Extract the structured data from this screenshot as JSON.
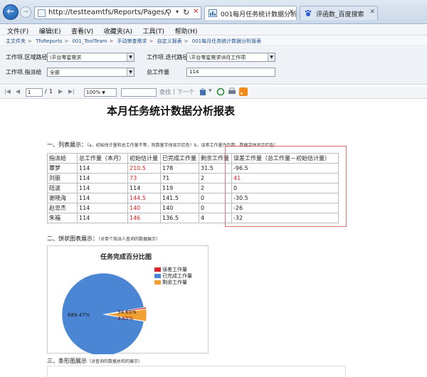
{
  "browser": {
    "address_url": "http://testteamtfs/Reports/Pages/",
    "tabs": [
      {
        "label": "001每月任务统计数据分析..."
      },
      {
        "label": "评函数_百度搜索"
      }
    ]
  },
  "menu": [
    "文件(F)",
    "编辑(E)",
    "查看(V)",
    "收藏夹(A)",
    "工具(T)",
    "帮助(H)"
  ],
  "breadcrumb": [
    "主文件夹",
    "TfsReports",
    "001_ToolTeam",
    "手动审查需求",
    "自定义报表",
    "001每月任务统计数据分析报表"
  ],
  "params": {
    "area_path_label": "工作项.区域路径",
    "area_path_value": "\\平台零星需求",
    "iteration_label": "工作项.迭代路径",
    "iteration_value": "\\平台零星需求\\8月工作项",
    "assigned_label": "工作项.指派给",
    "assigned_value": "全部",
    "total_label": "总工作量",
    "total_value": "114"
  },
  "report_toolbar": {
    "page_current": "1",
    "page_sep": "/",
    "page_total": "1",
    "zoom": "100%",
    "find_label": "查找",
    "next_label": "下一个"
  },
  "report": {
    "title": "本月任务统计数据分析报表",
    "section1_title": "一、列表展示：",
    "section1_note": "（a，初始估计量和总工作量不等，则数量字体显示红色！b，误差工作量为负数，数据字体显示红色）",
    "section2_title": "二、饼状图表展示：",
    "section2_note": "（对单个指派人查询的数据展示）",
    "section3_title": "三、条形图展示",
    "section3_note": "（对查询的数据总和的展示）",
    "table": {
      "headers": [
        "指派给",
        "总工作量（本月）",
        "初始估计量",
        "已完成工作量",
        "剩余工作量",
        "误差工作量（总工作量－初始估计量）"
      ],
      "rows": [
        {
          "name": "覃梦",
          "total": "114",
          "estimate": "210.5",
          "estimate_red": true,
          "done": "178",
          "remain": "31.5",
          "diff": "-96.5",
          "diff_red": false
        },
        {
          "name": "刘丽",
          "total": "114",
          "estimate": "73",
          "estimate_red": true,
          "done": "71",
          "remain": "2",
          "diff": "41",
          "diff_red": true
        },
        {
          "name": "陆波",
          "total": "114",
          "estimate": "114",
          "estimate_red": false,
          "done": "119",
          "remain": "2",
          "diff": "0",
          "diff_red": false
        },
        {
          "name": "谢晓海",
          "total": "114",
          "estimate": "144.5",
          "estimate_red": true,
          "done": "141.5",
          "remain": "0",
          "diff": "-30.5",
          "diff_red": false
        },
        {
          "name": "赵忠杰",
          "total": "114",
          "estimate": "140",
          "estimate_red": true,
          "done": "140",
          "remain": "0",
          "diff": "-26",
          "diff_red": false
        },
        {
          "name": "朱福",
          "total": "114",
          "estimate": "146",
          "estimate_red": true,
          "done": "136.5",
          "remain": "4",
          "diff": "-32",
          "diff_red": false
        }
      ]
    }
  },
  "chart_data": {
    "type": "pie",
    "title": "任务完成百分比图",
    "slices": [
      {
        "name": "误差工作量",
        "label": "4.65%",
        "value": 4.65,
        "color": "#d9262b"
      },
      {
        "name": "已完成工作量",
        "label": "689.47%",
        "value": 689.47,
        "color": "#4a86d4"
      },
      {
        "name": "剩余工作量",
        "label": "34.65%",
        "value": 34.65,
        "color": "#f0a032"
      }
    ],
    "legend_position": "right"
  },
  "colors": {
    "red_text": "#e0201f",
    "link": "#1f4f8f",
    "highlight_box": "#e36b6b"
  }
}
